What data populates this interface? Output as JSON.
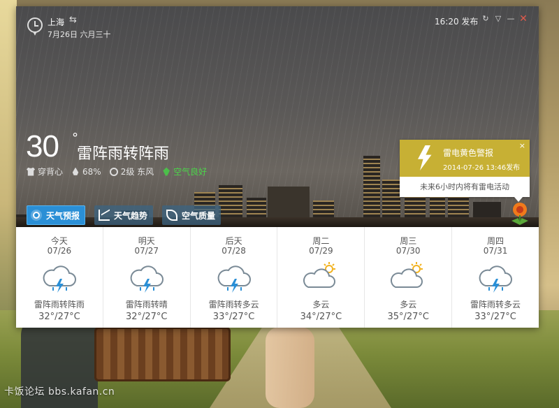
{
  "header": {
    "city": "上海",
    "switch_icon": "⇆",
    "date": "7月26日 六月三十",
    "publish_time": "16:20 发布"
  },
  "window_controls": {
    "refresh": "↻",
    "skin": "▽",
    "minimize": "—",
    "close": "✕"
  },
  "current": {
    "temperature": "30",
    "degree": "°",
    "condition": "雷阵雨转阵雨",
    "dress": "穿背心",
    "humidity": "68%",
    "wind": "2级 东风",
    "air": "空气良好"
  },
  "alert": {
    "title": "雷电黄色警报",
    "time": "2014-07-26 13:46发布",
    "message": "未来6小时内将有雷电活动",
    "close": "×",
    "color": "#c7b034"
  },
  "tabs": [
    {
      "label": "天气预报",
      "icon": "sun-icon",
      "active": true
    },
    {
      "label": "天气趋势",
      "icon": "trend-chart-icon",
      "active": false
    },
    {
      "label": "空气质量",
      "icon": "leaf-icon",
      "active": false
    }
  ],
  "forecast": [
    {
      "day": "今天",
      "date": "07/26",
      "condition": "雷阵雨转阵雨",
      "temp": "32°/27°C",
      "icon": "thunderstorm-icon"
    },
    {
      "day": "明天",
      "date": "07/27",
      "condition": "雷阵雨转晴",
      "temp": "32°/27°C",
      "icon": "thunderstorm-icon"
    },
    {
      "day": "后天",
      "date": "07/28",
      "condition": "雷阵雨转多云",
      "temp": "33°/27°C",
      "icon": "thunderstorm-icon"
    },
    {
      "day": "周二",
      "date": "07/29",
      "condition": "多云",
      "temp": "34°/27°C",
      "icon": "partly-cloudy-icon"
    },
    {
      "day": "周三",
      "date": "07/30",
      "condition": "多云",
      "temp": "35°/27°C",
      "icon": "partly-cloudy-icon"
    },
    {
      "day": "周四",
      "date": "07/31",
      "condition": "雷阵雨转多云",
      "temp": "33°/27°C",
      "icon": "thunderstorm-icon"
    }
  ],
  "watermark": "卡饭论坛 bbs.kafan.cn",
  "colors": {
    "accent_blue": "#2a8fd6",
    "air_good_green": "#4cd44a",
    "icon_blue": "#2a8fd6",
    "icon_grey": "#7a8a96",
    "sun_yellow": "#f2b21e"
  }
}
